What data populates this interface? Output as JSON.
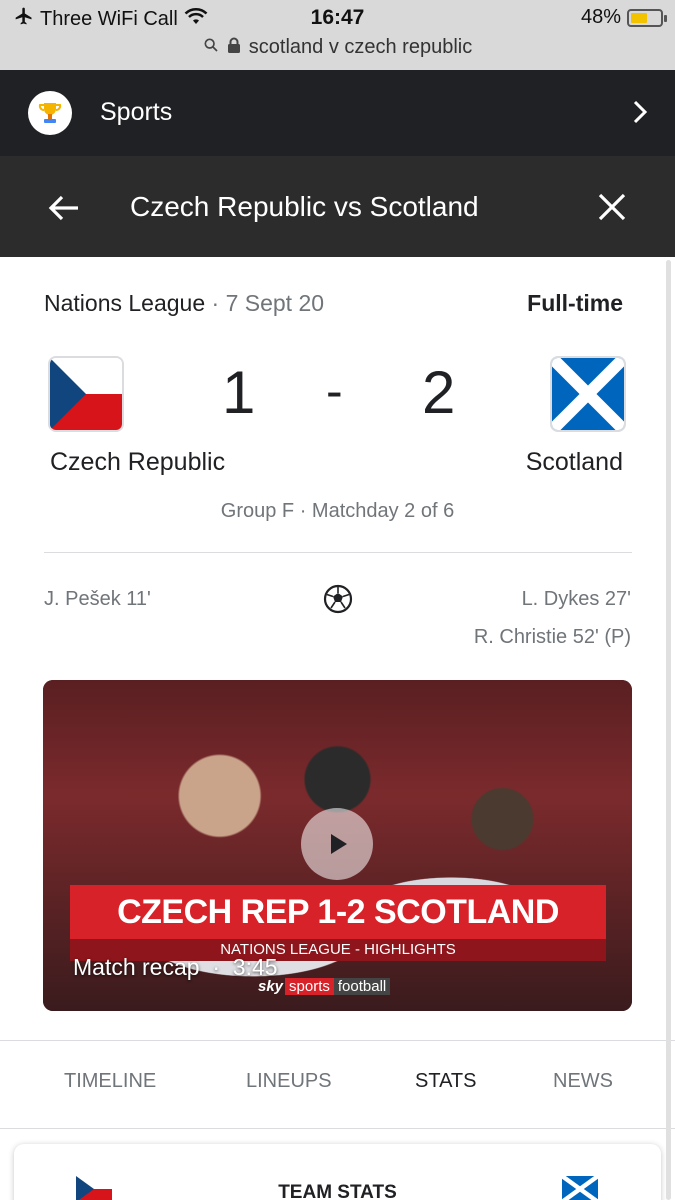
{
  "status_bar": {
    "carrier": "Three WiFi Call",
    "time": "16:47",
    "battery": "48%",
    "url": "scotland v czech republic"
  },
  "sports_bar": {
    "title": "Sports"
  },
  "header": {
    "title": "Czech Republic vs Scotland"
  },
  "match": {
    "competition": "Nations League",
    "date": "7 Sept 20",
    "status": "Full-time",
    "home_team": "Czech Republic",
    "away_team": "Scotland",
    "home_score": "1",
    "separator": "-",
    "away_score": "2",
    "group_info": "Group F · Matchday 2 of 6",
    "home_scorers": [
      "J. Pešek 11'"
    ],
    "away_scorers": [
      "L. Dykes 27'",
      "R. Christie 52' (P)"
    ]
  },
  "video": {
    "banner_title": "CZECH REP 1-2 SCOTLAND",
    "banner_subtitle": "NATIONS LEAGUE - HIGHLIGHTS",
    "label": "Match recap",
    "duration": "3:45",
    "broadcaster": {
      "sky": "sky",
      "sports": "sports",
      "football": "football"
    }
  },
  "tabs": [
    {
      "label": "TIMELINE",
      "active": false
    },
    {
      "label": "LINEUPS",
      "active": false
    },
    {
      "label": "STATS",
      "active": true
    },
    {
      "label": "NEWS",
      "active": false
    }
  ],
  "stats_card": {
    "title": "TEAM STATS"
  },
  "colors": {
    "header_bg": "#2c2c2c",
    "sports_bar_bg": "#202124",
    "muted_text": "#70757a",
    "banner_red": "#d8222a",
    "czech_blue": "#11457e",
    "czech_red": "#d7141a",
    "scotland_blue": "#0065bd"
  }
}
